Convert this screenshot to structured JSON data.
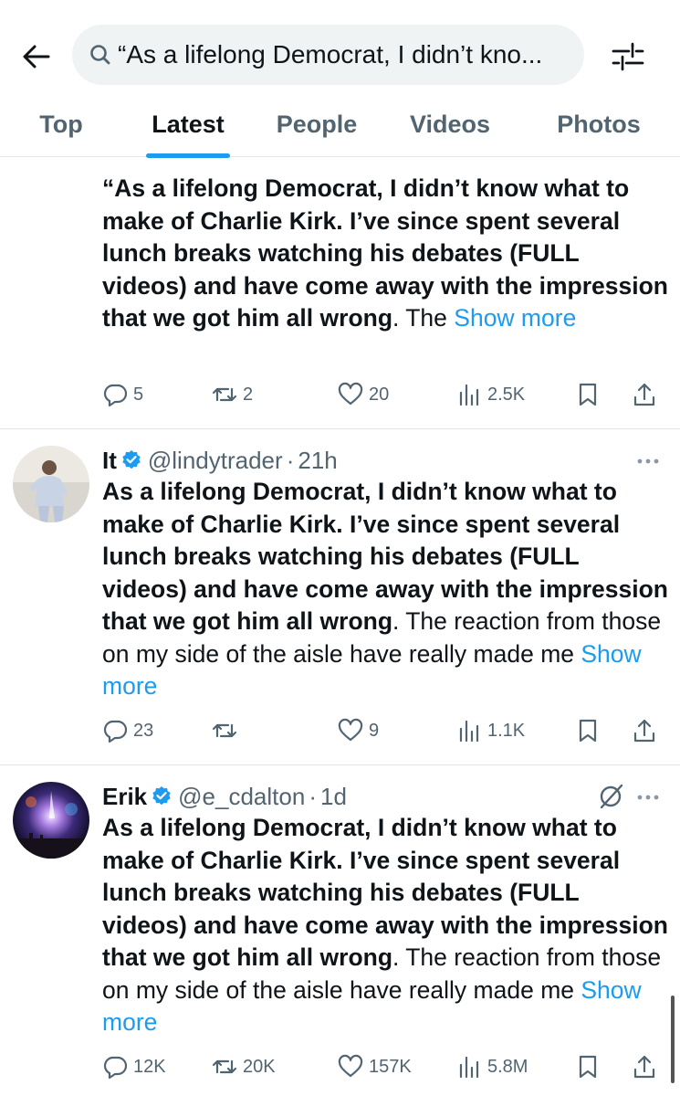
{
  "search": {
    "query": "“As a lifelong Democrat, I didn’t kno..."
  },
  "tabs": [
    "Top",
    "Latest",
    "People",
    "Videos",
    "Photos"
  ],
  "active_tab": "Latest",
  "accent_color": "#1d9bf0",
  "posts": [
    {
      "display_name": "",
      "handle": "",
      "time": "",
      "text_bold": "“As a lifelong Democrat, I didn’t know what to make of Charlie Kirk. I’ve since spent several lunch breaks watching his debates (FULL videos) and have come away with the impression that we got him all wrong",
      "text_rest": ". The ",
      "show_more": "Show more",
      "replies": "5",
      "reposts": "2",
      "likes": "20",
      "views": "2.5K"
    },
    {
      "display_name": "It",
      "verified": true,
      "handle": "@lindytrader",
      "dot": "·",
      "time": "21h",
      "text_bold": "As a lifelong Democrat, I didn’t know what to make of Charlie Kirk. I’ve since spent several lunch breaks watching his debates (FULL videos) and have come away with the impression that we got him all wrong",
      "text_rest": ". The reaction from those on my side of the aisle have really made me ",
      "show_more": "Show more",
      "replies": "23",
      "reposts": "",
      "likes": "9",
      "views": "1.1K"
    },
    {
      "display_name": "Erik",
      "verified": true,
      "handle": "@e_cdalton",
      "dot": "·",
      "time": "1d",
      "text_bold": "As a lifelong Democrat, I didn’t know what to make of Charlie Kirk. I’ve since spent several lunch breaks watching his debates (FULL videos) and have come away with the impression that we got him all wrong",
      "text_rest": ". The reaction from those on my side of the aisle have really made me ",
      "show_more": "Show more",
      "replies": "12K",
      "reposts": "20K",
      "likes": "157K",
      "views": "5.8M"
    }
  ],
  "icons": {
    "back": "back-arrow-icon",
    "search": "search-icon",
    "filter": "filter-sliders-icon",
    "reply": "reply-icon",
    "repost": "repost-icon",
    "like": "heart-icon",
    "views": "views-chart-icon",
    "bookmark": "bookmark-icon",
    "share": "share-icon",
    "verified": "verified-badge-icon",
    "more": "more-dots-icon",
    "grok": "grok-icon"
  }
}
